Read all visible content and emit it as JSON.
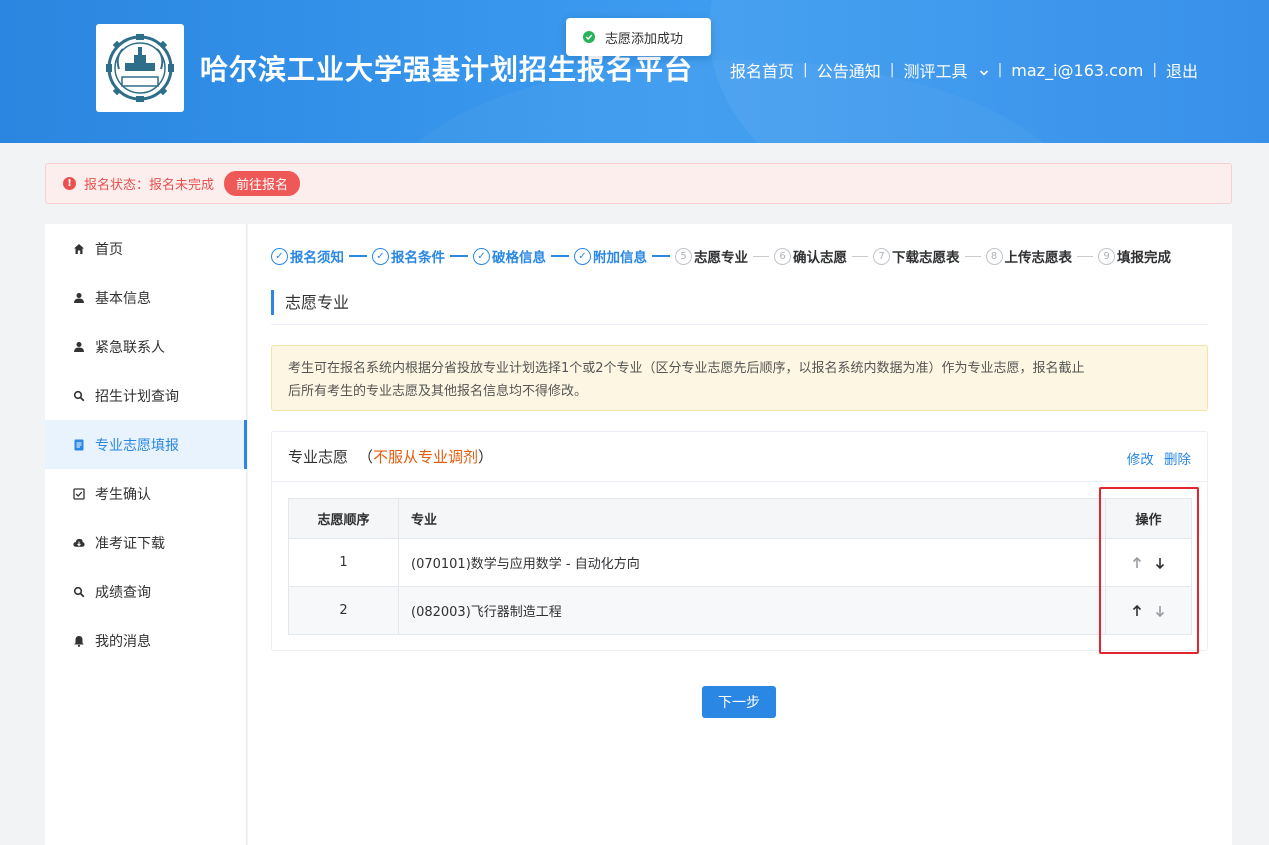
{
  "header": {
    "site_title": "哈尔滨工业大学强基计划招生报名平台",
    "nav": [
      {
        "label": "报名首页"
      },
      {
        "label": "公告通知"
      },
      {
        "label": "测评工具"
      },
      {
        "label": "maz_i@163.com"
      },
      {
        "label": "退出"
      }
    ],
    "nav_dropdown_icon": "chevron-down-icon"
  },
  "toast": {
    "message": "志愿添加成功",
    "icon": "check-circle-icon"
  },
  "status_bar": {
    "text": "报名状态：报名未完成",
    "action": "前往报名",
    "color": "#e9504f"
  },
  "sidebar": {
    "items": [
      {
        "label": "首页",
        "icon": "home-icon"
      },
      {
        "label": "基本信息",
        "icon": "user-icon"
      },
      {
        "label": "紧急联系人",
        "icon": "user-icon"
      },
      {
        "label": "招生计划查询",
        "icon": "search-icon"
      },
      {
        "label": "专业志愿填报",
        "icon": "document-icon"
      },
      {
        "label": "考生确认",
        "icon": "checkbox-icon"
      },
      {
        "label": "准考证下载",
        "icon": "cloud-download-icon"
      },
      {
        "label": "成绩查询",
        "icon": "search-icon"
      },
      {
        "label": "我的消息",
        "icon": "bell-icon"
      }
    ],
    "active_index": 4,
    "accent": "#2a87e4"
  },
  "steps": [
    {
      "num": "✓",
      "label": "报名须知",
      "state": "done"
    },
    {
      "num": "✓",
      "label": "报名条件",
      "state": "done"
    },
    {
      "num": "✓",
      "label": "破格信息",
      "state": "done"
    },
    {
      "num": "✓",
      "label": "附加信息",
      "state": "done"
    },
    {
      "num": "5",
      "label": "志愿专业",
      "state": "todo"
    },
    {
      "num": "6",
      "label": "确认志愿",
      "state": "todo"
    },
    {
      "num": "7",
      "label": "下载志愿表",
      "state": "todo"
    },
    {
      "num": "8",
      "label": "上传志愿表",
      "state": "todo"
    },
    {
      "num": "9",
      "label": "填报完成",
      "state": "todo"
    }
  ],
  "section_title": "志愿专业",
  "notice": {
    "line1": "考生可在报名系统内根据分省投放专业计划选择1个或2个专业（区分专业志愿先后顺序，以报名系统内数据为准）作为专业志愿，报名截止",
    "line2": "后所有考生的专业志愿及其他报名信息均不得修改。"
  },
  "card": {
    "title": "专业志愿",
    "paren_open": "（",
    "warning": "不服从专业调剂",
    "paren_close": "）",
    "edit_label": "修改",
    "delete_label": "删除",
    "table": {
      "headers": [
        "志愿顺序",
        "专业",
        "操作"
      ],
      "rows": [
        {
          "order": "1",
          "major": "(070101)数学与应用数学 - 自动化方向"
        },
        {
          "order": "2",
          "major": "(082003)飞行器制造工程"
        }
      ]
    }
  },
  "next_button": "下一步"
}
